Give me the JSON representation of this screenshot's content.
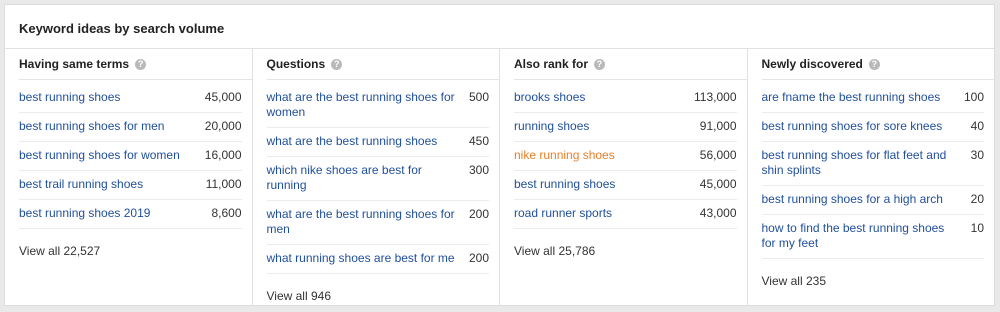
{
  "title": "Keyword ideas by search volume",
  "help_glyph": "?",
  "columns": [
    {
      "heading": "Having same terms",
      "rows": [
        {
          "keyword": "best running shoes",
          "volume": "45,000"
        },
        {
          "keyword": "best running shoes for men",
          "volume": "20,000"
        },
        {
          "keyword": "best running shoes for women",
          "volume": "16,000"
        },
        {
          "keyword": "best trail running shoes",
          "volume": "11,000"
        },
        {
          "keyword": "best running shoes 2019",
          "volume": "8,600"
        }
      ],
      "view_all": "View all 22,527"
    },
    {
      "heading": "Questions",
      "rows": [
        {
          "keyword": "what are the best running shoes for women",
          "volume": "500"
        },
        {
          "keyword": "what are the best running shoes",
          "volume": "450"
        },
        {
          "keyword": "which nike shoes are best for running",
          "volume": "300"
        },
        {
          "keyword": "what are the best running shoes for men",
          "volume": "200"
        },
        {
          "keyword": "what running shoes are best for me",
          "volume": "200"
        }
      ],
      "view_all": "View all 946"
    },
    {
      "heading": "Also rank for",
      "rows": [
        {
          "keyword": "brooks shoes",
          "volume": "113,000"
        },
        {
          "keyword": "running shoes",
          "volume": "91,000"
        },
        {
          "keyword": "nike running shoes",
          "volume": "56,000",
          "highlight": "#e8802a"
        },
        {
          "keyword": "best running shoes",
          "volume": "45,000"
        },
        {
          "keyword": "road runner sports",
          "volume": "43,000"
        }
      ],
      "view_all": "View all 25,786"
    },
    {
      "heading": "Newly discovered",
      "rows": [
        {
          "keyword": "are fname the best running shoes",
          "volume": "100"
        },
        {
          "keyword": "best running shoes for sore knees",
          "volume": "40"
        },
        {
          "keyword": "best running shoes for flat feet and shin splints",
          "volume": "30"
        },
        {
          "keyword": "best running shoes for a high arch",
          "volume": "20"
        },
        {
          "keyword": "how to find the best running shoes for my feet",
          "volume": "10"
        }
      ],
      "view_all": "View all 235"
    }
  ],
  "colors": {
    "link": "#1f4f9c",
    "highlight": "#e8802a"
  }
}
